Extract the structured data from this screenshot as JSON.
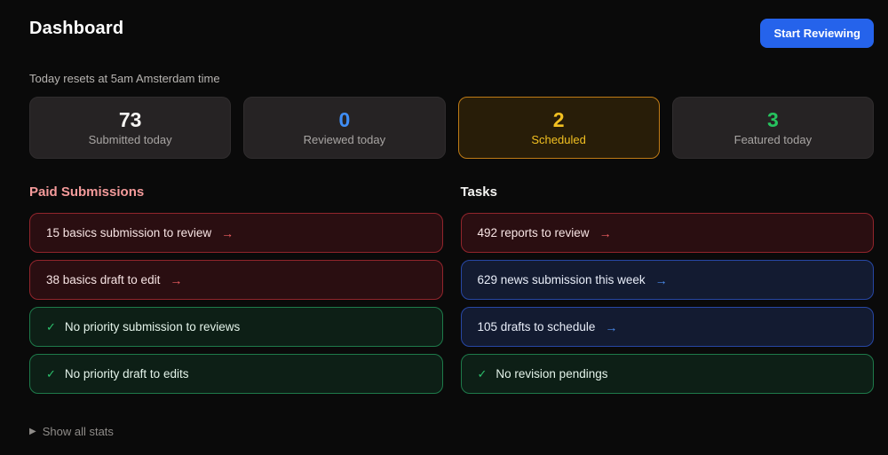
{
  "page": {
    "title": "Dashboard",
    "subtitle": "Today resets at 5am Amsterdam time",
    "show_all_stats_label": "Show all stats"
  },
  "header": {
    "start_reviewing_label": "Start Reviewing"
  },
  "colors": {
    "accent_button": "#2563eb",
    "stat_white": "#f5f4f2",
    "stat_blue": "#3f8ef6",
    "stat_yellow": "#f2c021",
    "stat_green": "#26c35e",
    "alert_border": "#92252c",
    "info_border": "#2747a5",
    "done_border": "#1e7a4a",
    "paid_submissions_heading": "#f59b9b"
  },
  "stats": [
    {
      "value": "73",
      "label": "Submitted today"
    },
    {
      "value": "0",
      "label": "Reviewed today"
    },
    {
      "value": "2",
      "label": "Scheduled"
    },
    {
      "value": "3",
      "label": "Featured today"
    }
  ],
  "sections": [
    {
      "title": "Paid Submissions",
      "items": [
        {
          "text": "15 basics submission to review",
          "status": "alert"
        },
        {
          "text": "38 basics draft to edit",
          "status": "alert"
        },
        {
          "text": "No priority submission to reviews",
          "status": "done"
        },
        {
          "text": "No priority draft to edits",
          "status": "done"
        }
      ]
    },
    {
      "title": "Tasks",
      "items": [
        {
          "text": "492 reports to review",
          "status": "alert"
        },
        {
          "text": "629 news submission this week",
          "status": "info"
        },
        {
          "text": "105 drafts to schedule",
          "status": "info"
        },
        {
          "text": "No revision pendings",
          "status": "done"
        }
      ]
    }
  ],
  "icons": {
    "arrow_right": "→",
    "check": "✓",
    "triangle_right": "▶"
  }
}
